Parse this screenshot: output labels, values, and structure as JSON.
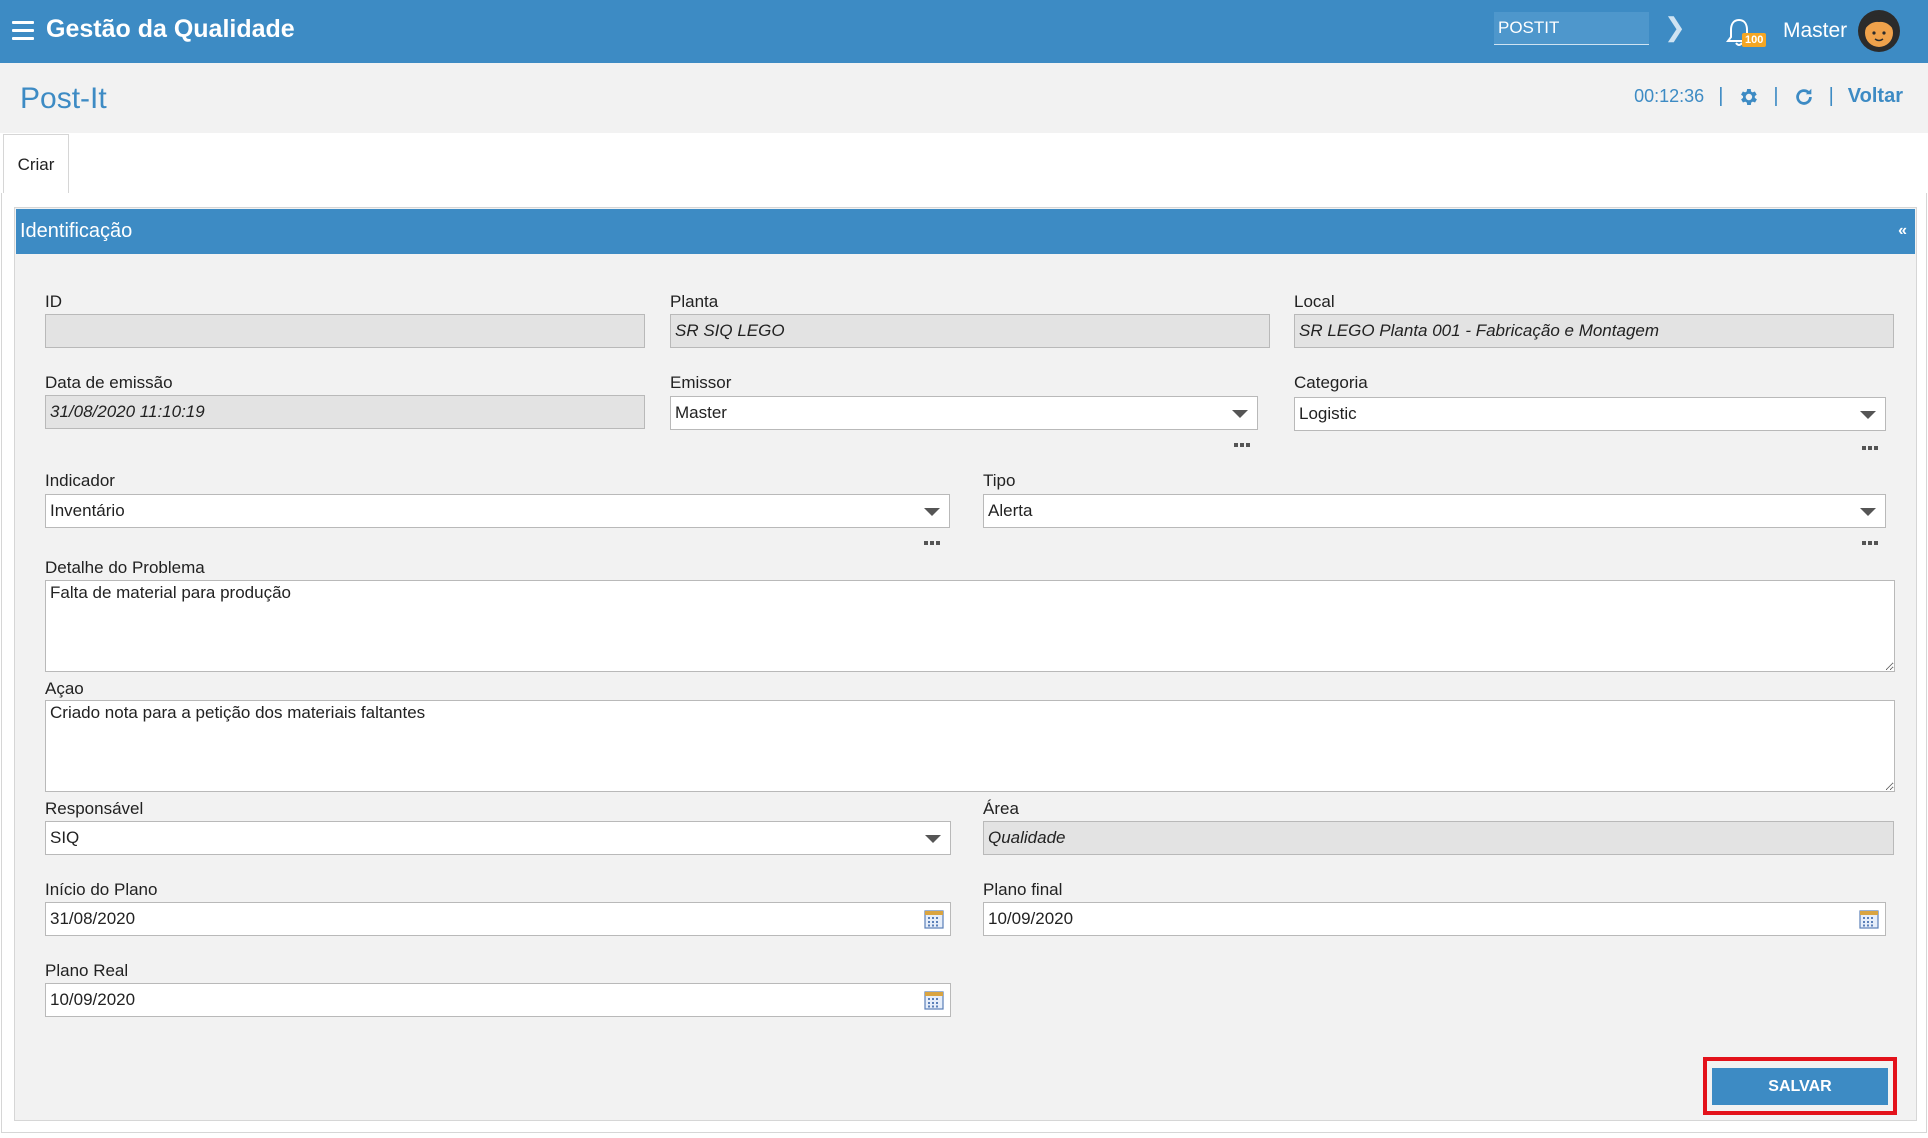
{
  "topbar": {
    "app_title": "Gestão da Qualidade",
    "search_value": "POSTIT",
    "notification_count": "100",
    "user_name": "Master"
  },
  "page": {
    "title": "Post-It",
    "timer": "00:12:36",
    "back_label": "Voltar"
  },
  "tabs": [
    {
      "label": "Criar"
    }
  ],
  "section": {
    "title": "Identificação",
    "collapse": "«"
  },
  "form": {
    "id": {
      "label": "ID",
      "value": ""
    },
    "planta": {
      "label": "Planta",
      "value": "SR SIQ LEGO"
    },
    "local": {
      "label": "Local",
      "value": "SR LEGO Planta 001 - Fabricação e Montagem"
    },
    "data_emissao": {
      "label": "Data de emissão",
      "value": "31/08/2020 11:10:19"
    },
    "emissor": {
      "label": "Emissor",
      "value": "Master"
    },
    "categoria": {
      "label": "Categoria",
      "value": "Logistic"
    },
    "indicador": {
      "label": "Indicador",
      "value": "Inventário"
    },
    "tipo": {
      "label": "Tipo",
      "value": "Alerta"
    },
    "detalhe": {
      "label": "Detalhe do Problema",
      "value": "Falta de material para produção"
    },
    "acao": {
      "label": "Açao",
      "value": "Criado nota para a petição dos materiais faltantes"
    },
    "responsavel": {
      "label": "Responsável",
      "value": "SIQ"
    },
    "area": {
      "label": "Área",
      "value": "Qualidade"
    },
    "inicio_plano": {
      "label": "Início do Plano",
      "value": "31/08/2020"
    },
    "plano_final": {
      "label": "Plano final",
      "value": "10/09/2020"
    },
    "plano_real": {
      "label": "Plano Real",
      "value": "10/09/2020"
    }
  },
  "actions": {
    "save_label": "SALVAR"
  },
  "colors": {
    "primary": "#3d8bc4",
    "highlight": "#e3121b",
    "badge": "#f5a623"
  }
}
